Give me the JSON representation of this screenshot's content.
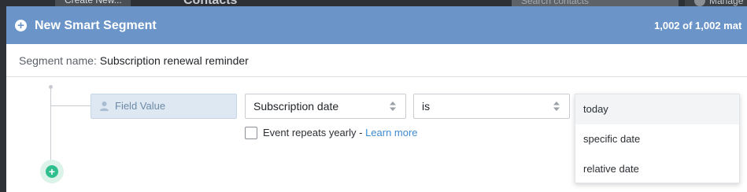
{
  "background_app": {
    "create_button": "Create New...",
    "title": "Contacts",
    "search_placeholder": "Search contacts",
    "manage_button": "Manage"
  },
  "modal": {
    "title": "New Smart Segment",
    "match_count": "1,002 of 1,002 mat",
    "segment_name_label": "Segment name:",
    "segment_name_value": "Subscription renewal reminder"
  },
  "condition": {
    "field_chip_label": "Field Value",
    "field_select_value": "Subscription date",
    "operator_select_value": "is",
    "repeat_label": "Event repeats yearly - ",
    "learn_more": "Learn more",
    "repeat_checked": false
  },
  "date_options": [
    {
      "label": "today",
      "highlighted": true
    },
    {
      "label": "specific date",
      "highlighted": false
    },
    {
      "label": "relative date",
      "highlighted": false
    }
  ],
  "colors": {
    "header": "#6b95c8",
    "add_button": "#2fbf8f",
    "link": "#3f8bd1"
  }
}
